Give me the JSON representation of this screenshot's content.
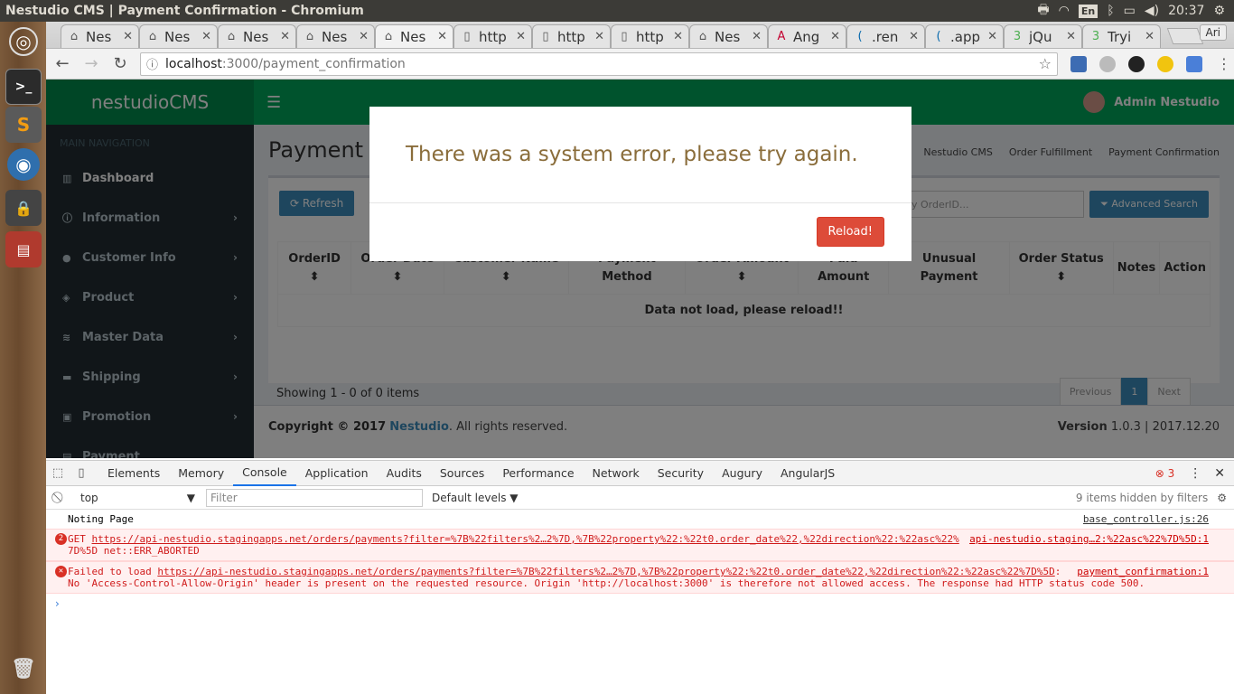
{
  "window_title": "Nestudio CMS | Payment Confirmation - Chromium",
  "tray": {
    "lang": "En",
    "time": "20:37"
  },
  "tabs": [
    {
      "icon": "nestudio",
      "label": "Nes"
    },
    {
      "icon": "nestudio",
      "label": "Nes"
    },
    {
      "icon": "nestudio",
      "label": "Nes"
    },
    {
      "icon": "nestudio",
      "label": "Nes"
    },
    {
      "icon": "nestudio",
      "label": "Nes",
      "active": true
    },
    {
      "icon": "page",
      "label": "http"
    },
    {
      "icon": "page",
      "label": "http"
    },
    {
      "icon": "page",
      "label": "http"
    },
    {
      "icon": "nestudio",
      "label": "Nes"
    },
    {
      "icon": "angular",
      "label": "Ang"
    },
    {
      "icon": "jquery",
      "label": ".ren"
    },
    {
      "icon": "jquery",
      "label": ".app"
    },
    {
      "icon": "w3",
      "label": "jQu"
    },
    {
      "icon": "w3",
      "label": "Tryi"
    }
  ],
  "profile_name": "Ari",
  "omnibox": {
    "host": "localhost",
    "path": ":3000/payment_confirmation"
  },
  "app": {
    "logo": "nestudioCMS",
    "user": "Admin Nestudio",
    "sidebar_header": "MAIN NAVIGATION",
    "sidebar_items": [
      {
        "icon": "dashboard-icon",
        "label": "Dashboard"
      },
      {
        "icon": "info-icon",
        "label": "Information"
      },
      {
        "icon": "user-icon",
        "label": "Customer Info"
      },
      {
        "icon": "cube-icon",
        "label": "Product"
      },
      {
        "icon": "layers-icon",
        "label": "Master Data"
      },
      {
        "icon": "truck-icon",
        "label": "Shipping"
      },
      {
        "icon": "gift-icon",
        "label": "Promotion"
      },
      {
        "icon": "money-icon",
        "label": "Payment"
      }
    ],
    "page_title": "Payment Co",
    "breadcrumbs": [
      "Nestudio CMS",
      "Order Fulfillment",
      "Payment Confirmation"
    ],
    "refresh_label": "Refresh",
    "search_placeholder": "y OrderID...",
    "advanced_search_label": "Advanced Search",
    "table_headers": [
      "OrderID",
      "Order Date",
      "Customer Name",
      "Payment Method",
      "Order Amount",
      "Paid Amount",
      "Unusual Payment",
      "Order Status",
      "Notes",
      "Action"
    ],
    "empty_message": "Data not load, please reload!!",
    "showing": "Showing 1 - 0 of 0 items",
    "pager": {
      "prev": "Previous",
      "current": "1",
      "next": "Next"
    },
    "footer_copyright": "Copyright © 2017",
    "footer_brand": "Nestudio",
    "footer_rights": ". All rights reserved.",
    "footer_version_label": "Version",
    "footer_version": "1.0.3 | 2017.12.20"
  },
  "modal": {
    "message": "There was a system error, please try again.",
    "button": "Reload!"
  },
  "devtools": {
    "tabs": [
      "Elements",
      "Memory",
      "Console",
      "Application",
      "Audits",
      "Sources",
      "Performance",
      "Network",
      "Security",
      "Augury",
      "AngularJS"
    ],
    "active_tab": "Console",
    "error_count": "3",
    "context": "top",
    "filter_placeholder": "Filter",
    "levels": "Default levels",
    "hidden_note": "9 items hidden by filters",
    "messages": [
      {
        "type": "log",
        "text": "Noting Page",
        "source": "base_controller.js:26"
      },
      {
        "type": "error",
        "count": "2",
        "line1_prefix": "GET ",
        "line1_url": "https://api-nestudio.stagingapps.net/orders/payments?filter=%7B%22filters%2…2%7D,%7B%22property%22:%22t0.order_date%22,%22direction%22:%22asc%22%",
        "line2": "7D%5D net::ERR_ABORTED",
        "source": "api-nestudio.staging…2:%22asc%22%7D%5D:1"
      },
      {
        "type": "error",
        "line1_prefix": "Failed to load ",
        "line1_url": "https://api-nestudio.stagingapps.net/orders/payments?filter=%7B%22filters%2…2%7D,%7B%22property%22:%22t0.order_date%22,%22direction%22:%22asc%22%7D%5D",
        "line1_suffix": ":",
        "line2": "No 'Access-Control-Allow-Origin' header is present on the requested resource. Origin 'http://localhost:3000' is therefore not allowed access. The response had HTTP status code 500.",
        "source": "payment_confirmation:1"
      }
    ]
  }
}
